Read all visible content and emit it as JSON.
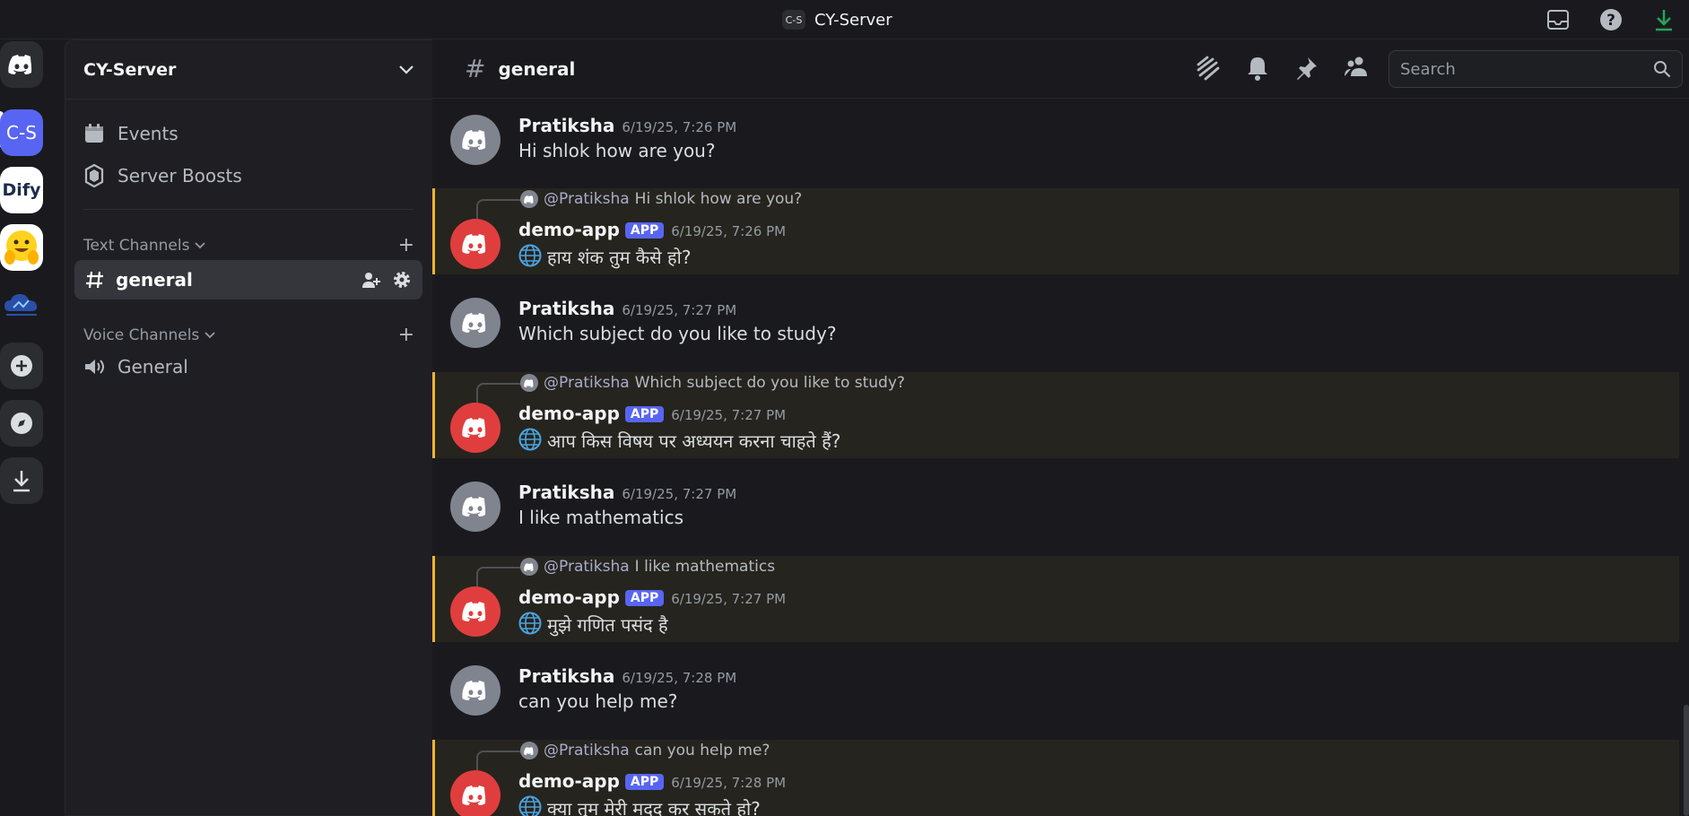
{
  "titlebar": {
    "badge": "C-S",
    "title": "CY-Server",
    "icons": [
      "inbox-icon",
      "help-icon",
      "download-icon"
    ]
  },
  "rail": {
    "items": [
      {
        "name": "discord-home",
        "label": ""
      },
      {
        "name": "server-cs",
        "label": "C-S"
      },
      {
        "name": "server-dify",
        "label": "Dify"
      },
      {
        "name": "server-huggingface",
        "label": ""
      },
      {
        "name": "server-cloud",
        "label": ""
      },
      {
        "name": "add-server",
        "label": ""
      },
      {
        "name": "explore",
        "label": ""
      },
      {
        "name": "download-apps",
        "label": ""
      }
    ]
  },
  "sidebar": {
    "server_name": "CY-Server",
    "events": "Events",
    "boosts": "Server Boosts",
    "text_channels": "Text Channels",
    "active_channel": "general",
    "voice_channels": "Voice Channels",
    "voice_channel": "General"
  },
  "header": {
    "channel": "general",
    "search_placeholder": "Search"
  },
  "messages": [
    {
      "type": "user",
      "author": "Pratiksha",
      "time": "6/19/25, 7:26 PM",
      "text": "Hi shlok how are you?"
    },
    {
      "type": "bot",
      "reply_mention": "@Pratiksha",
      "reply_text": "Hi shlok how are you?",
      "author": "demo-app",
      "tag": "APP",
      "time": "6/19/25, 7:26 PM",
      "text": "हाय शंक तुम कैसे हो?"
    },
    {
      "type": "user",
      "author": "Pratiksha",
      "time": "6/19/25, 7:27 PM",
      "text": "Which subject do you like to study?"
    },
    {
      "type": "bot",
      "reply_mention": "@Pratiksha",
      "reply_text": "Which subject do you like to study?",
      "author": "demo-app",
      "tag": "APP",
      "time": "6/19/25, 7:27 PM",
      "text": "आप किस विषय पर अध्ययन करना चाहते हैं?"
    },
    {
      "type": "user",
      "author": "Pratiksha",
      "time": "6/19/25, 7:27 PM",
      "text": "I like mathematics"
    },
    {
      "type": "bot",
      "reply_mention": "@Pratiksha",
      "reply_text": "I like mathematics",
      "author": "demo-app",
      "tag": "APP",
      "time": "6/19/25, 7:27 PM",
      "text": "मुझे गणित पसंद है"
    },
    {
      "type": "user",
      "author": "Pratiksha",
      "time": "6/19/25, 7:28 PM",
      "text": "can you help me?"
    },
    {
      "type": "bot",
      "reply_mention": "@Pratiksha",
      "reply_text": "can you help me?",
      "author": "demo-app",
      "tag": "APP",
      "time": "6/19/25, 7:28 PM",
      "text": "क्या तुम मेरी मदद कर सकते हो?"
    }
  ],
  "colors": {
    "accent": "#5865f2",
    "bot_highlight": "#f0b232",
    "bot_avatar": "#e03e3e",
    "user_avatar": "#80848e"
  }
}
